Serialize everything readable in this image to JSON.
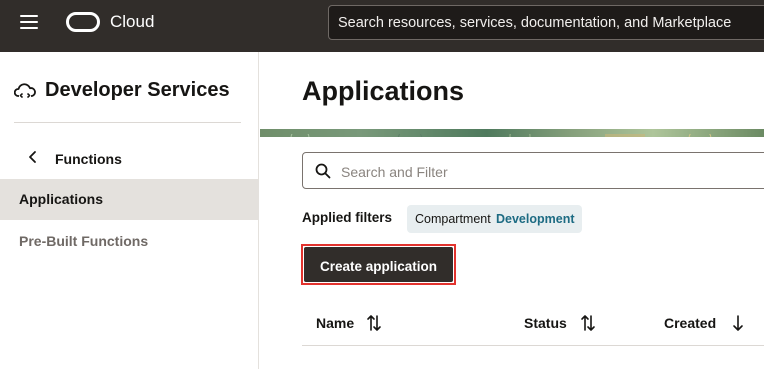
{
  "header": {
    "brand": "Cloud",
    "search_placeholder": "Search resources, services, documentation, and Marketplace"
  },
  "sidebar": {
    "service_title": "Developer Services",
    "back_label": "Functions",
    "items": [
      {
        "label": "Applications",
        "active": true
      },
      {
        "label": "Pre-Built Functions",
        "active": false
      }
    ]
  },
  "main": {
    "title": "Applications",
    "filter_placeholder": "Search and Filter",
    "applied_filters_label": "Applied filters",
    "filter_chip": {
      "key": "Compartment",
      "value": "Development"
    },
    "create_button": "Create application",
    "columns": [
      {
        "label": "Name",
        "sort": "sortable"
      },
      {
        "label": "Status",
        "sort": "sortable"
      },
      {
        "label": "Created",
        "sort": "descending"
      }
    ]
  },
  "colors": {
    "topbar": "#312d2a",
    "accent_link": "#1d6b83",
    "highlight_border": "#e2332e"
  }
}
